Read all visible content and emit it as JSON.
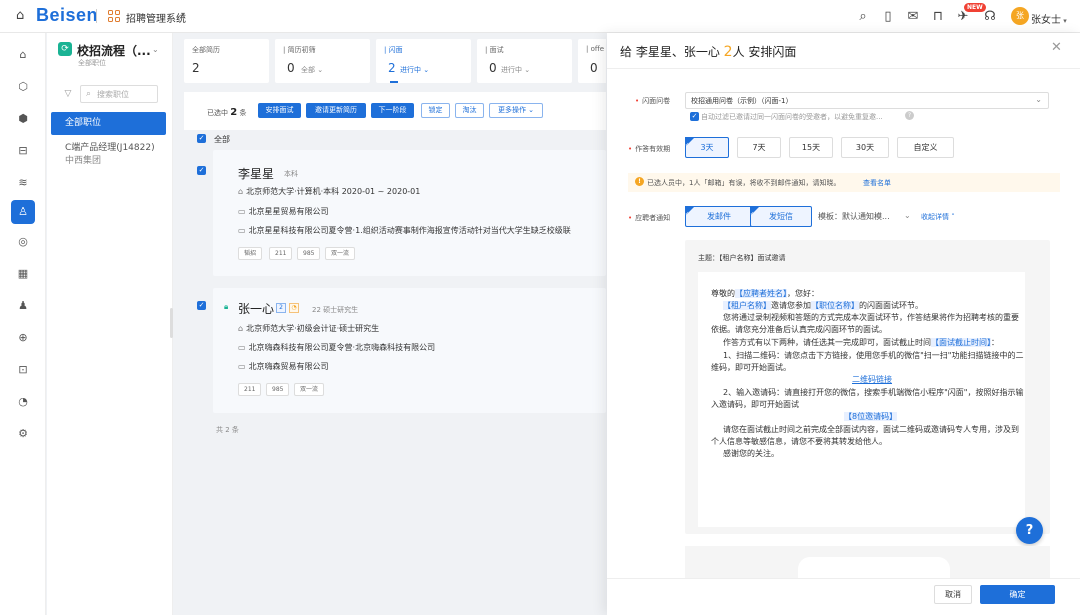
{
  "header": {
    "logo": "Beisen",
    "app_title": "招聘管理系统",
    "new_badge": "NEW",
    "user_avatar": "张",
    "user_name": "张女士"
  },
  "sidebar": {
    "title": "校招流程（...",
    "subtitle": "全部职位",
    "search_placeholder": "搜索职位",
    "active_item": "全部职位",
    "item_title": "C端产品经理(J14822)",
    "item_sub": "中西集团"
  },
  "stages": [
    {
      "label": "全部简历",
      "count": "2",
      "sub": ""
    },
    {
      "label": "| 简历初筛",
      "count": "0",
      "sub": "全部 ⌄"
    },
    {
      "label": "| 闪面",
      "count": "2",
      "sub": "进行中 ⌄"
    },
    {
      "label": "| 面试",
      "count": "0",
      "sub": "进行中 ⌄"
    },
    {
      "label": "| offe",
      "count": "0",
      "sub": ""
    }
  ],
  "toolbar": {
    "selected_prefix": "已选中",
    "selected_count": "2",
    "selected_suffix": "条",
    "btn_schedule": "安排面试",
    "btn_invite": "邀请更新简历",
    "btn_next": "下一阶段",
    "btn_lock": "锁定",
    "btn_reject": "淘汰",
    "btn_more": "更多操作 ⌄"
  },
  "list": {
    "select_all": "全部",
    "total": "共 2 条",
    "candidates": [
      {
        "name": "李星星",
        "degree": "本科",
        "edu": "北京师范大学·计算机·本科    2020-01 ~ 2020-01",
        "company": "北京星星贸易有限公司",
        "project": "北京星星科技有限公司夏令营·1.组织活动赛事制作海报宣传活动针对当代大学生缺乏校级联",
        "tags": [
          "韬招",
          "211",
          "985",
          "双一流"
        ]
      },
      {
        "name": "张一心",
        "badge_num": "2",
        "age_degree": "22  硕士研究生",
        "edu": "北京师范大学·初级会计证·硕士研究生",
        "company": "北京嗨森科技有限公司夏令营·北京嗨森科技有限公司",
        "project": "北京嗨森贸易有限公司",
        "tags": [
          "211",
          "985",
          "双一流"
        ]
      }
    ]
  },
  "panel": {
    "title_prefix": "给 李星星、张一心 ",
    "title_count": "2",
    "title_suffix": "人 安排闪面",
    "questionnaire_label": "闪面问卷",
    "questionnaire_value": "校招通用问卷（示例）（闪面-1）",
    "questionnaire_hint": "自动过滤已邀请过同一闪面问卷的受邀者，以避免重复邀...",
    "validity_label": "作答有效期",
    "validity_options": [
      "3天",
      "7天",
      "15天",
      "30天",
      "自定义"
    ],
    "notice_text": "已选人员中，1人「邮箱」有误，将收不到邮件通知，请知晓。",
    "notice_link": "查看名单",
    "notify_label": "应聘者通知",
    "notify_email": "发邮件",
    "notify_sms": "发短信",
    "template_label": "模板：默认通知模...",
    "collapse_label": "收起详情 ˄",
    "subject": "主题：【租户名称】面试邀请",
    "body": {
      "l1": "尊敬的",
      "l1_var": "【应聘者姓名】",
      "l1_end": "，您好：",
      "l2_var": "【租户名称】",
      "l2_mid": "邀请您参加",
      "l2_var2": "【职位名称】",
      "l2_end": "的闪面面试环节。",
      "l3": "您将通过录制视频和答题的方式完成本次面试环节，作答结果将作为招聘考核的重要",
      "l4": "依据。请您充分准备后认真完成闪面环节的面试。",
      "l5": "作答方式有以下两种，请任选其一完成即可，面试截止时间",
      "l5_var": "【面试截止时间】",
      "l5_end": "：",
      "l6": "1、扫描二维码：请您点击下方链接，使用您手机的微信\"扫一扫\"功能扫描链接中的二",
      "l7": "维码，即可开始面试。",
      "l8_link": "二维码链接",
      "l9": "2、输入邀请码：请直接打开您的微信，搜索手机端微信小程序\"闪面\"，按照好指示输",
      "l10": "入邀请码，即可开始面试",
      "l11_var": "【8位邀请码】",
      "l12": "请您在面试截止时间之前完成全部面试内容，面试二维码或邀请码专人专用，涉及到",
      "l13": "个人信息等敏感信息，请您不要将其转发给他人。",
      "l14": "感谢您的关注。"
    },
    "help": "?",
    "cancel": "取消",
    "confirm": "确定"
  }
}
